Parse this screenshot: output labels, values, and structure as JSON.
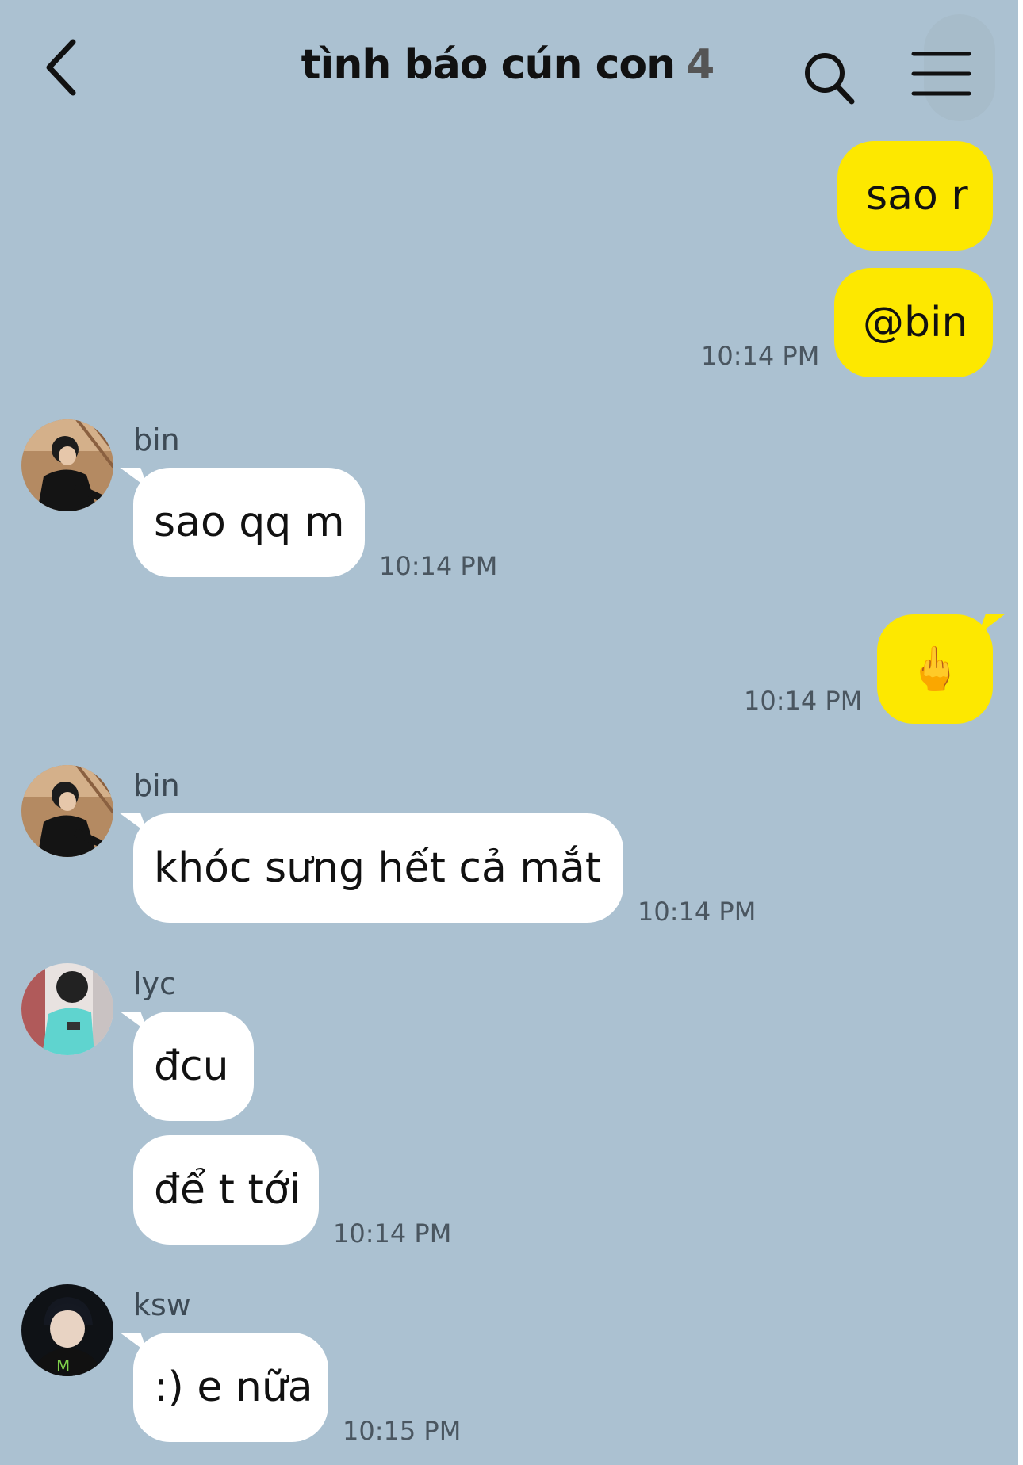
{
  "header": {
    "title": "tình báo cún con",
    "member_count": "4"
  },
  "messages": {
    "m1": {
      "text": "sao r"
    },
    "m2": {
      "text": "@bin",
      "time": "10:14 PM"
    },
    "m3": {
      "sender": "bin",
      "text": "sao qq m",
      "time": "10:14 PM"
    },
    "m4": {
      "text": "🖕",
      "time": "10:14 PM"
    },
    "m5": {
      "sender": "bin",
      "text": "khóc sưng hết cả mắt",
      "time": "10:14 PM"
    },
    "m6": {
      "sender": "lyc",
      "text": "đcu"
    },
    "m7": {
      "text": "để t tới",
      "time": "10:14 PM"
    },
    "m8": {
      "sender": "ksw",
      "text": ":) e nữa",
      "time": "10:15 PM"
    }
  },
  "colors": {
    "background": "#abc1d1",
    "mine_bubble": "#fde800",
    "their_bubble": "#ffffff"
  },
  "icons": {
    "back": "chevron-left-icon",
    "search": "search-icon",
    "menu": "hamburger-menu-icon"
  }
}
